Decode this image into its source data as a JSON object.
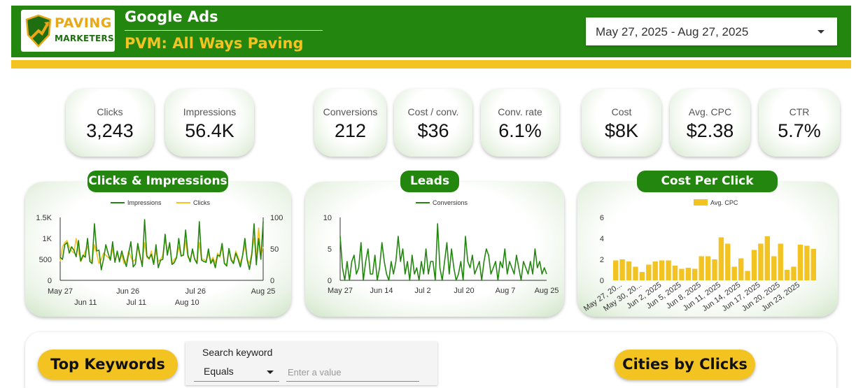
{
  "header": {
    "logo_line1": "PAVING",
    "logo_line2": "MARKETERS",
    "title": "Google Ads",
    "subtitle": "PVM: All Ways Paving",
    "date_range": "May 27, 2025 - Aug 27, 2025"
  },
  "kpis": [
    {
      "label": "Clicks",
      "value": "3,243"
    },
    {
      "label": "Impressions",
      "value": "56.4K"
    },
    {
      "label": "Conversions",
      "value": "212"
    },
    {
      "label": "Cost / conv.",
      "value": "$36"
    },
    {
      "label": "Conv. rate",
      "value": "6.1%"
    },
    {
      "label": "Cost",
      "value": "$8K"
    },
    {
      "label": "Avg. CPC",
      "value": "$2.38"
    },
    {
      "label": "CTR",
      "value": "5.7%"
    }
  ],
  "panels": {
    "clicks_impressions_title": "Clicks & Impressions",
    "leads_title": "Leads",
    "cpc_title": "Cost Per Click"
  },
  "colors": {
    "green": "#23870f",
    "yellow": "#f3c322"
  },
  "chart_data": [
    {
      "type": "line",
      "legend": [
        "Impressions",
        "Clicks"
      ],
      "left_ticks": [
        "1.5K",
        "1K",
        "500",
        "0"
      ],
      "right_ticks": [
        "100",
        "50",
        "0"
      ],
      "x_ticks_top": [
        "May 27",
        "Jun 26",
        "Jul 26",
        "Aug 25"
      ],
      "x_ticks_bottom": [
        "Jun 11",
        "Jul 11",
        "Aug 10"
      ],
      "ylim": [
        0,
        1500
      ],
      "y2lim": [
        0,
        100
      ],
      "series": [
        {
          "name": "Impressions",
          "axis": "left",
          "values": [
            550,
            500,
            850,
            900,
            650,
            800,
            720,
            560,
            950,
            460,
            600,
            550,
            1000,
            450,
            400,
            1350,
            700,
            720,
            250,
            500,
            850,
            650,
            480,
            920,
            430,
            700,
            440,
            700,
            500,
            330,
            640,
            920,
            320,
            390,
            880,
            600,
            330,
            1450,
            580,
            520,
            620,
            380,
            850,
            300,
            480,
            500,
            1100,
            600,
            900,
            380,
            420,
            540,
            1000,
            580,
            600,
            1200,
            600,
            440,
            750,
            500,
            400,
            1400,
            480,
            450,
            430,
            750,
            400,
            500,
            300,
            600,
            580,
            880,
            400,
            340,
            760,
            480,
            400,
            650,
            500,
            320,
            600,
            1000,
            480,
            260,
            600,
            1350,
            370,
            1000,
            500,
            1400
          ]
        },
        {
          "name": "Clicks",
          "axis": "left",
          "values": [
            450,
            800,
            900,
            950,
            800,
            700,
            650,
            1000,
            700,
            450,
            550,
            700,
            800,
            500,
            450,
            850,
            650,
            400,
            500,
            650,
            600,
            550,
            500,
            750,
            450,
            650,
            500,
            600,
            400,
            450,
            700,
            550,
            450,
            500,
            800,
            550,
            400,
            900,
            550,
            500,
            700,
            400,
            700,
            450,
            500,
            600,
            1000,
            650,
            850,
            400,
            500,
            550,
            800,
            600,
            600,
            950,
            550,
            500,
            700,
            500,
            450,
            900,
            500,
            500,
            450,
            650,
            450,
            550,
            400,
            650,
            550,
            800,
            400,
            400,
            700,
            500,
            450,
            700,
            550,
            400,
            600,
            850,
            500,
            400,
            650,
            1000,
            500,
            1250,
            600,
            800
          ]
        }
      ]
    },
    {
      "type": "line",
      "legend": [
        "Conversions"
      ],
      "y_ticks": [
        "10",
        "5",
        "0"
      ],
      "x_ticks": [
        "May 27",
        "Jun 14",
        "Jul 2",
        "Jul 20",
        "Aug 7",
        "Aug 25"
      ],
      "ylim": [
        0,
        10
      ],
      "series": [
        {
          "name": "Conversions",
          "values": [
            7,
            2,
            0,
            3,
            0,
            3,
            4,
            1,
            2,
            6,
            0,
            3,
            5,
            1,
            1,
            4,
            0,
            2,
            6,
            3,
            1,
            0,
            3,
            1,
            3,
            7,
            3,
            5,
            1,
            3,
            0,
            4,
            1,
            2,
            0,
            3,
            1,
            5,
            1,
            3,
            3,
            0,
            9,
            2,
            0,
            3,
            6,
            1,
            5,
            2,
            0,
            1,
            3,
            0,
            7,
            3,
            2,
            4,
            1,
            2,
            3,
            0,
            3,
            5,
            4,
            1,
            2,
            3,
            0,
            3,
            2,
            5,
            1,
            3,
            2,
            1,
            4,
            2,
            0,
            3,
            2,
            1,
            3,
            1,
            5,
            2,
            3,
            1,
            2,
            1
          ]
        }
      ]
    },
    {
      "type": "bar",
      "legend": [
        "Avg. CPC"
      ],
      "y_ticks": [
        "6",
        "4",
        "2",
        "0"
      ],
      "ylim": [
        0,
        6
      ],
      "x_tick_labels": [
        "May 27, 20...",
        "May 30, 20...",
        "Jun 2, 2025",
        "Jun 5, 2025",
        "Jun 8, 2025",
        "Jun 11, 2025",
        "Jun 14, 2025",
        "Jun 17, 2025",
        "Jun 20, 2025",
        "Jun 23, 2025"
      ],
      "series": [
        {
          "name": "Avg. CPC",
          "values": [
            1.9,
            2.0,
            1.8,
            1.3,
            0.8,
            1.5,
            1.8,
            1.9,
            1.9,
            1.4,
            1.1,
            1.2,
            1.1,
            2.3,
            2.3,
            2.0,
            4.1,
            3.5,
            1.3,
            2.1,
            0.9,
            2.9,
            3.5,
            4.2,
            2.3,
            3.5,
            1.0,
            1.3,
            3.4,
            3.3,
            3.0
          ]
        }
      ]
    }
  ],
  "bottom": {
    "top_keywords": "Top Keywords",
    "cities": "Cities by Clicks",
    "filter_label": "Search keyword",
    "filter_operator": "Equals",
    "filter_placeholder": "Enter a value"
  }
}
